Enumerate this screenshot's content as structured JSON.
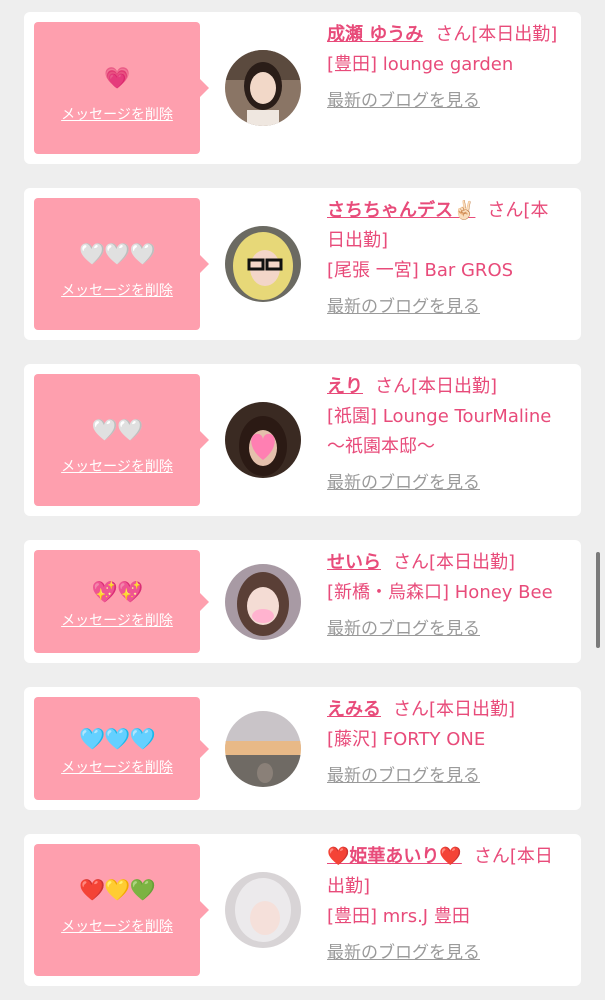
{
  "delete_label": "メッセージを削除",
  "san_suffix": "さん",
  "blog_label": "最新のブログを見る",
  "colors": {
    "accent": "#e84b7a",
    "bubble": "#fe9fae",
    "background": "#eeeeee"
  },
  "cards": [
    {
      "name": "成瀬 ゆうみ",
      "status": "[本日出勤]",
      "venue": "[豊田] lounge garden",
      "hearts": "💗",
      "avatar": "avatar-photo"
    },
    {
      "name": "さちちゃんデス✌🏻",
      "status": "[本日出勤]",
      "venue": "[尾張 一宮] Bar GROS",
      "hearts": "🤍🤍🤍",
      "avatar": "avatar-photo"
    },
    {
      "name": "えり",
      "status": "[本日出勤]",
      "venue": "[祇園] Lounge TourMaline 〜祇園本邸〜",
      "hearts": "🤍🤍",
      "avatar": "avatar-photo"
    },
    {
      "name": "せいら",
      "status": "[本日出勤]",
      "venue": "[新橋・烏森口] Honey Bee",
      "hearts": "💖💖",
      "avatar": "avatar-photo"
    },
    {
      "name": "えみる",
      "status": "[本日出勤]",
      "venue": "[藤沢] FORTY ONE",
      "hearts": "🩵🩵🩵",
      "avatar": "avatar-photo"
    },
    {
      "name": "❤️姫華あいり❤️",
      "status": "[本日出勤]",
      "venue": "[豊田] mrs.J 豊田",
      "hearts": "❤️💛💚",
      "avatar": "avatar-photo"
    }
  ]
}
